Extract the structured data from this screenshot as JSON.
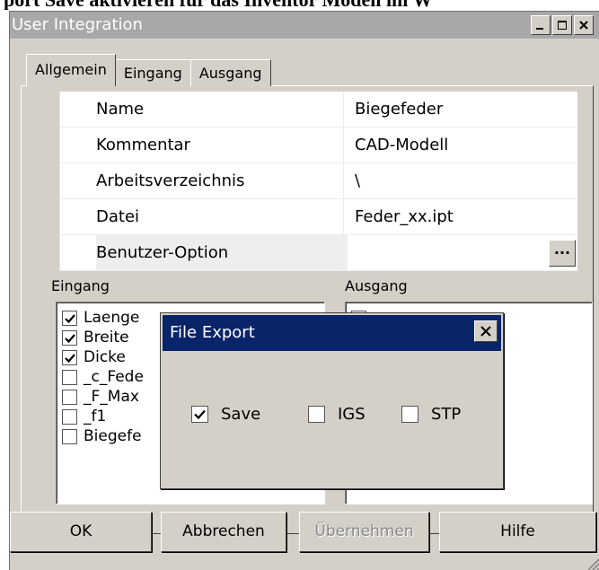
{
  "document_heading": "port  Save aktivieren für das Inventor Modell im W",
  "window": {
    "title": "User Integration",
    "controls": [
      "minimize-icon",
      "maximize-icon",
      "close-icon"
    ]
  },
  "tabs": [
    {
      "label": "Allgemein",
      "active": true
    },
    {
      "label": "Eingang",
      "active": false
    },
    {
      "label": "Ausgang",
      "active": false
    }
  ],
  "properties": [
    {
      "name": "Name",
      "value": "Biegefeder"
    },
    {
      "name": "Kommentar",
      "value": "CAD-Modell"
    },
    {
      "name": "Arbeitsverzeichnis",
      "value": "\\"
    },
    {
      "name": "Datei",
      "value": "Feder_xx.ipt"
    },
    {
      "name": "Benutzer-Option",
      "value": "",
      "button_label": "..."
    }
  ],
  "input_group": {
    "label": "Eingang",
    "items": [
      {
        "label": "Laenge",
        "checked": true
      },
      {
        "label": "Breite",
        "checked": true
      },
      {
        "label": "Dicke",
        "checked": true
      },
      {
        "label": "_c_Fede",
        "checked": false
      },
      {
        "label": "_F_Max",
        "checked": false
      },
      {
        "label": "_f1",
        "checked": false
      },
      {
        "label": "Biegefe",
        "checked": false
      }
    ]
  },
  "output_group": {
    "label": "Ausgang",
    "items": [
      {
        "label": "",
        "checked": false
      }
    ]
  },
  "file_export_dialog": {
    "title": "File Export",
    "options": [
      {
        "label": "Save",
        "checked": true
      },
      {
        "label": "IGS",
        "checked": false
      },
      {
        "label": "STP",
        "checked": false
      }
    ]
  },
  "buttons": {
    "ok": "OK",
    "cancel": "Abbrechen",
    "apply": "Übernehmen",
    "help": "Hilfe"
  },
  "colors": {
    "dialog_face": "#d4d0c8",
    "inactive_titlebar": "#a8a8a8",
    "active_titlebar": "#0a246a"
  }
}
